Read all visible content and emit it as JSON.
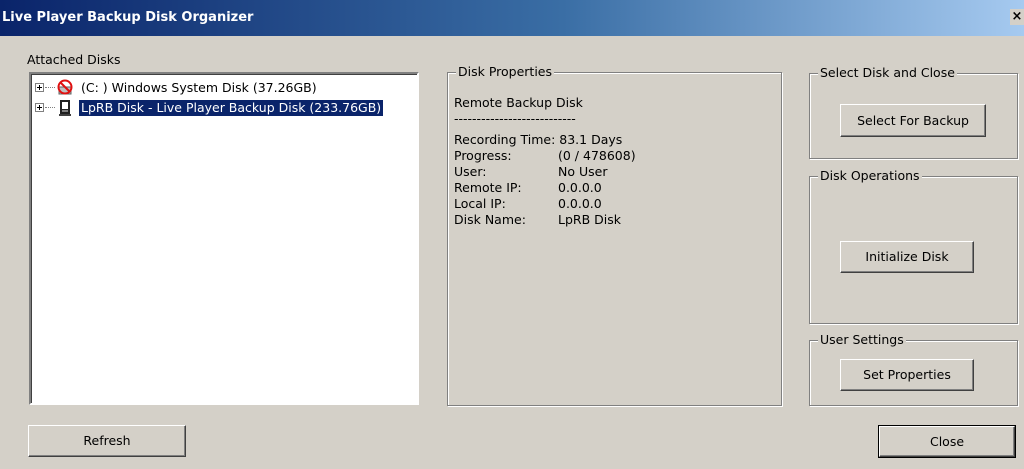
{
  "window": {
    "title": "Live Player Backup Disk Organizer",
    "close_glyph": "×"
  },
  "attached_disks": {
    "label": "Attached Disks",
    "items": [
      {
        "label": "(C: ) Windows System Disk (37.26GB)",
        "icon": "no-entry-disk-icon",
        "selected": false
      },
      {
        "label": "LpRB Disk - Live Player Backup Disk  (233.76GB)",
        "icon": "backup-disk-icon",
        "selected": true
      }
    ]
  },
  "disk_properties": {
    "legend": "Disk Properties",
    "heading": "Remote Backup Disk",
    "separator": "---------------------------",
    "recording_time": "Recording Time: 83.1 Days",
    "rows": [
      {
        "key": "Progress:",
        "value": "(0 / 478608)"
      },
      {
        "key": "User:",
        "value": "No User"
      },
      {
        "key": "Remote IP:",
        "value": "0.0.0.0"
      },
      {
        "key": "Local IP:",
        "value": "0.0.0.0"
      },
      {
        "key": "Disk Name:",
        "value": "LpRB Disk"
      }
    ]
  },
  "select_disk": {
    "legend": "Select Disk and Close",
    "button": "Select For Backup"
  },
  "disk_operations": {
    "legend": "Disk Operations",
    "button": "Initialize Disk"
  },
  "user_settings": {
    "legend": "User Settings",
    "button": "Set Properties"
  },
  "footer": {
    "refresh": "Refresh",
    "close": "Close"
  }
}
